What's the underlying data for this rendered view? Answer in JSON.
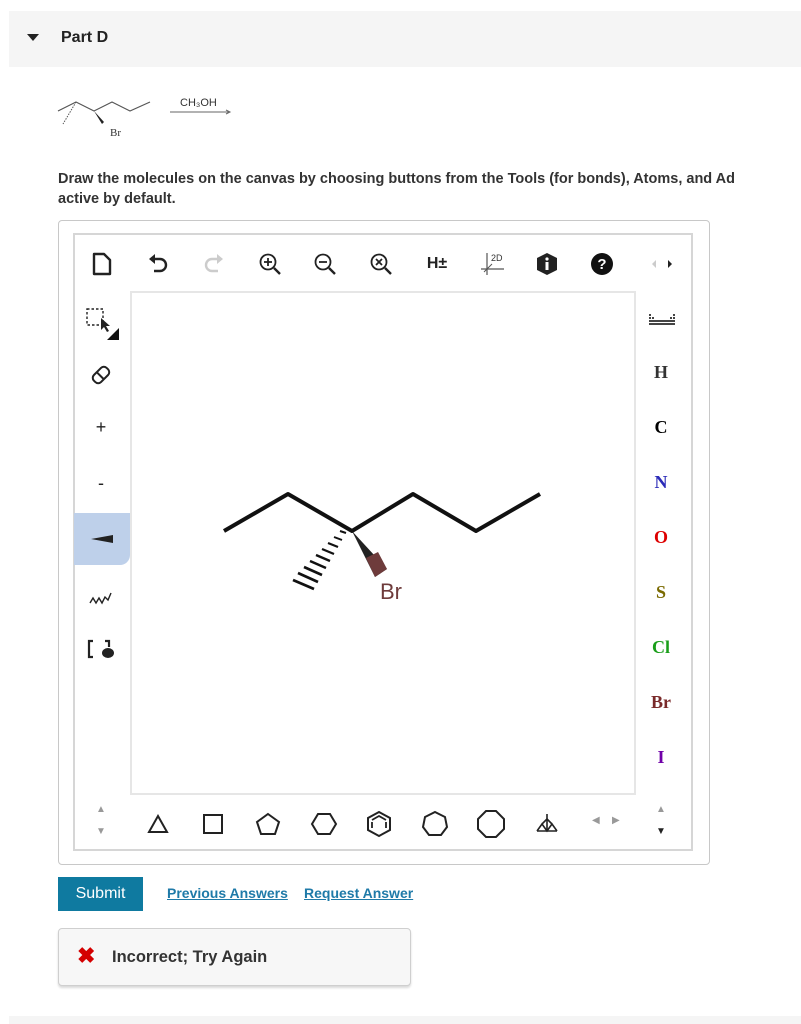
{
  "part": {
    "title": "Part D"
  },
  "reaction": {
    "reagent": "CH₃OH",
    "substituent_label": "Br"
  },
  "instructions": {
    "line1": "Draw the molecules on the canvas by choosing buttons from the Tools (for bonds), Atoms, and Ad",
    "line2": "active by default."
  },
  "toolbar_top": {
    "items": [
      "new-document-icon",
      "undo-icon",
      "redo-icon",
      "zoom-in-icon",
      "zoom-out-icon",
      "zoom-reset-icon",
      "explicit-hydrogens",
      "clean-2d-icon",
      "info-icon",
      "help-icon",
      "panel-arrows-icon"
    ],
    "h_toggle_label": "H±",
    "clean_label": "2D"
  },
  "toolbar_left": {
    "items": [
      "selection-icon",
      "eraser-icon",
      "charge-plus",
      "charge-minus",
      "bond-wedge-icon",
      "chain-icon",
      "bracket-icon"
    ],
    "plus_label": "+",
    "minus_label": "-",
    "active": "bond-wedge-icon"
  },
  "atoms": [
    {
      "symbol": "H",
      "color": "#333333"
    },
    {
      "symbol": "C",
      "color": "#000000"
    },
    {
      "symbol": "N",
      "color": "#2b2bb8"
    },
    {
      "symbol": "O",
      "color": "#dd0000"
    },
    {
      "symbol": "S",
      "color": "#7a6a00"
    },
    {
      "symbol": "Cl",
      "color": "#1a9e1a"
    },
    {
      "symbol": "Br",
      "color": "#7a2a2a"
    },
    {
      "symbol": "I",
      "color": "#7000a8"
    }
  ],
  "shapes_bottom": [
    "cyclopropane-icon",
    "cyclobutane-icon",
    "cyclopentane-icon",
    "cyclohexane-icon",
    "benzene-icon",
    "cycloheptane-icon",
    "cyclooctane-icon",
    "bicyclic-icon"
  ],
  "canvas": {
    "atom_label": "Br",
    "atom_label_color": "#6e3b3b"
  },
  "actions": {
    "submit": "Submit",
    "previous_answers": "Previous Answers",
    "request_answer": "Request Answer"
  },
  "feedback": {
    "icon": "✖",
    "message": "Incorrect; Try Again"
  }
}
